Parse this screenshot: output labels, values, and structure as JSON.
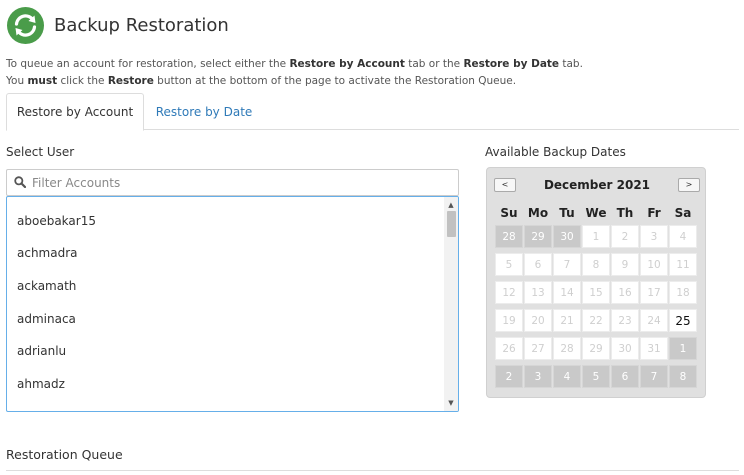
{
  "header": {
    "title": "Backup Restoration",
    "icon": "backup-restore-icon",
    "icon_color": "#4a9c4a"
  },
  "intro": {
    "line1_a": "To queue an account for restoration, select either the ",
    "line1_b": "Restore by Account",
    "line1_c": " tab or the ",
    "line1_d": "Restore by Date",
    "line1_e": " tab.",
    "line2_a": "You ",
    "line2_b": "must",
    "line2_c": " click the ",
    "line2_d": "Restore",
    "line2_e": " button at the bottom of the page to activate the Restoration Queue."
  },
  "tabs": [
    {
      "label": "Restore by Account",
      "active": true
    },
    {
      "label": "Restore by Date",
      "active": false
    }
  ],
  "select_user": {
    "label": "Select User",
    "placeholder": "Filter Accounts",
    "users": [
      "aboebakar15",
      "achmadra",
      "ackamath",
      "adminaca",
      "adrianlu",
      "ahmadz"
    ]
  },
  "calendar": {
    "label": "Available Backup Dates",
    "prev": "<",
    "next": ">",
    "month": "December 2021",
    "weekdays": [
      "Su",
      "Mo",
      "Tu",
      "We",
      "Th",
      "Fr",
      "Sa"
    ],
    "weeks": [
      [
        {
          "d": "28",
          "s": "other"
        },
        {
          "d": "29",
          "s": "other"
        },
        {
          "d": "30",
          "s": "other"
        },
        {
          "d": "1",
          "s": "disabled"
        },
        {
          "d": "2",
          "s": "disabled"
        },
        {
          "d": "3",
          "s": "disabled"
        },
        {
          "d": "4",
          "s": "disabled"
        }
      ],
      [
        {
          "d": "5",
          "s": "disabled"
        },
        {
          "d": "6",
          "s": "disabled"
        },
        {
          "d": "7",
          "s": "disabled"
        },
        {
          "d": "8",
          "s": "disabled"
        },
        {
          "d": "9",
          "s": "disabled"
        },
        {
          "d": "10",
          "s": "disabled"
        },
        {
          "d": "11",
          "s": "disabled"
        }
      ],
      [
        {
          "d": "12",
          "s": "disabled"
        },
        {
          "d": "13",
          "s": "disabled"
        },
        {
          "d": "14",
          "s": "disabled"
        },
        {
          "d": "15",
          "s": "disabled"
        },
        {
          "d": "16",
          "s": "disabled"
        },
        {
          "d": "17",
          "s": "disabled"
        },
        {
          "d": "18",
          "s": "disabled"
        }
      ],
      [
        {
          "d": "19",
          "s": "disabled"
        },
        {
          "d": "20",
          "s": "disabled"
        },
        {
          "d": "21",
          "s": "disabled"
        },
        {
          "d": "22",
          "s": "disabled"
        },
        {
          "d": "23",
          "s": "disabled"
        },
        {
          "d": "24",
          "s": "disabled"
        },
        {
          "d": "25",
          "s": "enabled"
        }
      ],
      [
        {
          "d": "26",
          "s": "disabled"
        },
        {
          "d": "27",
          "s": "disabled"
        },
        {
          "d": "28",
          "s": "disabled"
        },
        {
          "d": "29",
          "s": "disabled"
        },
        {
          "d": "30",
          "s": "disabled"
        },
        {
          "d": "31",
          "s": "disabled"
        },
        {
          "d": "1",
          "s": "other"
        }
      ],
      [
        {
          "d": "2",
          "s": "other"
        },
        {
          "d": "3",
          "s": "other"
        },
        {
          "d": "4",
          "s": "other"
        },
        {
          "d": "5",
          "s": "other"
        },
        {
          "d": "6",
          "s": "other"
        },
        {
          "d": "7",
          "s": "other"
        },
        {
          "d": "8",
          "s": "other"
        }
      ]
    ]
  },
  "queue": {
    "title": "Restoration Queue"
  },
  "colors": {
    "link": "#2f7ab8",
    "focus_border": "#66afe9",
    "brand_green": "#4a9c4a"
  }
}
